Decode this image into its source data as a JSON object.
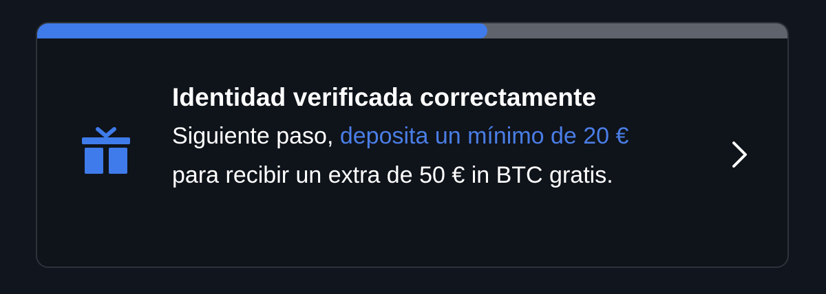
{
  "progress": {
    "fraction": 0.6,
    "fill_color": "#3f7bea",
    "track_color": "#5f646c"
  },
  "card": {
    "title": "Identidad verificada correctamente",
    "desc_before": "Siguiente paso, ",
    "desc_link": "deposita un mínimo de 20 €",
    "desc_after": " para recibir un extra de 50 € in BTC gratis.",
    "link_color": "#4a7ee6",
    "icon": "gift-icon",
    "chevron_icon": "chevron-right-icon"
  }
}
